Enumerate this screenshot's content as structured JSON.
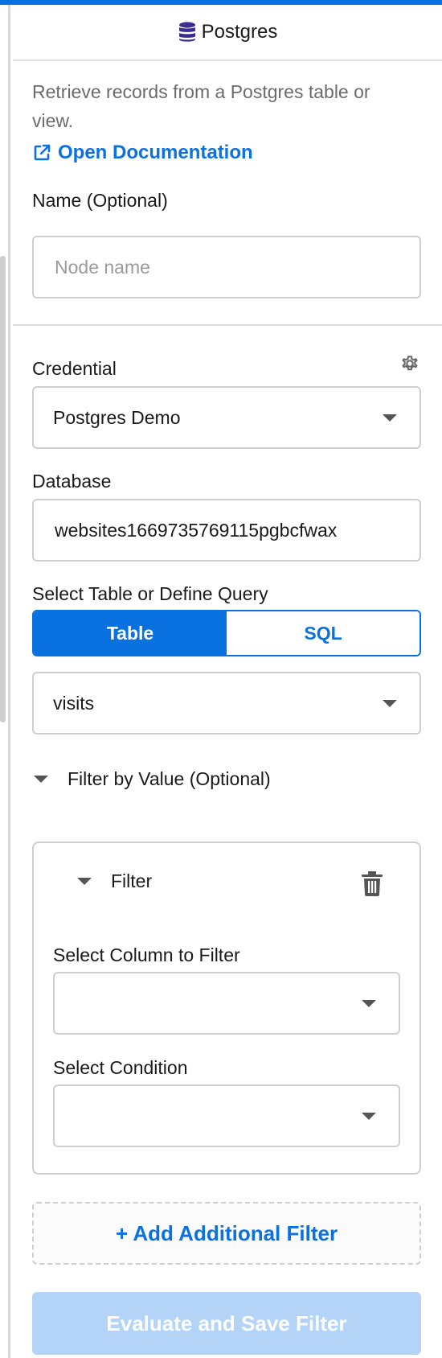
{
  "header": {
    "title": "Postgres",
    "icon": "database-icon"
  },
  "description": "Retrieve records from a Postgres table or view.",
  "doc_link": {
    "label": "Open Documentation",
    "icon": "external-link-icon"
  },
  "name_field": {
    "label": "Name (Optional)",
    "placeholder": "Node name",
    "value": ""
  },
  "credential": {
    "label": "Credential",
    "value": "Postgres Demo",
    "settings_icon": "gear-icon"
  },
  "database": {
    "label": "Database",
    "value": "websites1669735769115pgbcfwax"
  },
  "source": {
    "label": "Select Table or Define Query",
    "options": [
      "Table",
      "SQL"
    ],
    "selected": "Table",
    "table_value": "visits"
  },
  "filter_section": {
    "heading": "Filter by Value (Optional)",
    "filter": {
      "title": "Filter",
      "column_label": "Select Column to Filter",
      "column_value": "",
      "condition_label": "Select Condition",
      "condition_value": ""
    },
    "add_label": "+ Add Additional Filter",
    "evaluate_label": "Evaluate and Save Filter"
  },
  "colors": {
    "accent": "#0a72e0",
    "disabled_button": "#b3d4f6",
    "border": "#cfcfcf"
  }
}
